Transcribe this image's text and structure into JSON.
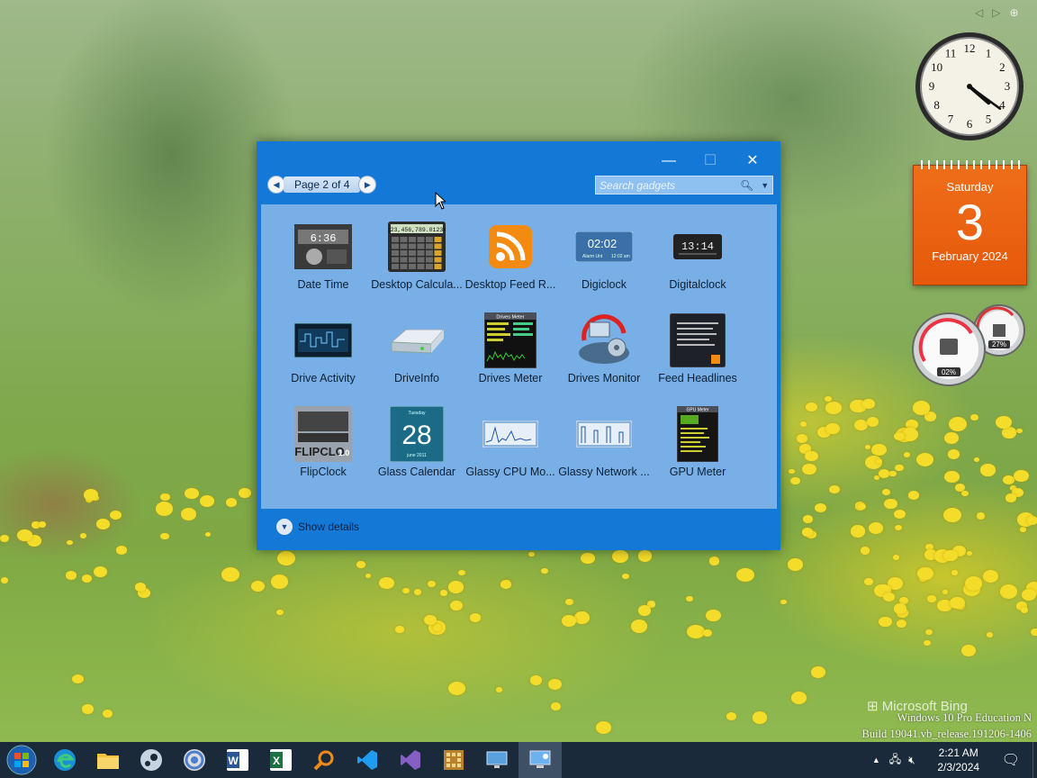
{
  "window": {
    "minimize": "—",
    "maximize": "☐",
    "close": "✕",
    "page_label": "Page 2 of 4",
    "search_placeholder": "Search gadgets",
    "show_details": "Show details"
  },
  "gadgets": [
    {
      "label": "Date Time",
      "icon": "date-time-icon"
    },
    {
      "label": "Desktop Calcula...",
      "icon": "calculator-icon",
      "display": "123,456,789.01234"
    },
    {
      "label": "Desktop Feed R...",
      "icon": "rss-feed-icon"
    },
    {
      "label": "Digiclock",
      "icon": "digiclock-icon",
      "display": "02:02",
      "sub": "Alarm Unt",
      "sub2": "12:02 am"
    },
    {
      "label": "Digitalclock",
      "icon": "digitalclock-icon",
      "display": "13:14"
    },
    {
      "label": "Drive Activity",
      "icon": "drive-activity-icon"
    },
    {
      "label": "DriveInfo",
      "icon": "driveinfo-icon"
    },
    {
      "label": "Drives Meter",
      "icon": "drives-meter-icon",
      "title": "Drives Meter"
    },
    {
      "label": "Drives Monitor",
      "icon": "drives-monitor-icon"
    },
    {
      "label": "Feed Headlines",
      "icon": "feed-headlines-icon"
    },
    {
      "label": "FlipClock",
      "icon": "flipclock-icon",
      "brand": "FLIPCLO",
      "version": "1.0"
    },
    {
      "label": "Glass Calendar",
      "icon": "glass-calendar-icon",
      "cal_day": "Tuesday",
      "cal_num": "28",
      "cal_month": "june 2011"
    },
    {
      "label": "Glassy CPU Mo...",
      "icon": "glassy-cpu-icon"
    },
    {
      "label": "Glassy Network ...",
      "icon": "glassy-network-icon"
    },
    {
      "label": "GPU Meter",
      "icon": "gpu-meter-icon",
      "title": "GPU Meter"
    }
  ],
  "desktop": {
    "calendar": {
      "weekday": "Saturday",
      "day": "3",
      "month": "February 2024"
    },
    "meter": {
      "cpu": "02%",
      "ram": "27%"
    },
    "clock": {
      "hour": 4,
      "minute": 21,
      "numbers": [
        "12",
        "1",
        "2",
        "3",
        "4",
        "5",
        "6",
        "7",
        "8",
        "9",
        "10",
        "11"
      ]
    },
    "bing_logo": "Microsoft Bing",
    "watermark_line1": "Windows 10 Pro Education N",
    "watermark_line2": "Build 19041.vb_release.191206-1406"
  },
  "taskbar": {
    "apps": [
      "start-orb",
      "edge",
      "file-explorer",
      "steam",
      "chrome",
      "word",
      "excel",
      "search-tool",
      "vscode",
      "visual-studio",
      "hex-app",
      "remote-desktop",
      "gadgets"
    ],
    "time": "2:21 AM",
    "date": "2/3/2024"
  },
  "colors": {
    "window": "#1479d6",
    "panel": "#77afe6",
    "calendar": "#e6580b",
    "taskbar": "#1b2a3a"
  }
}
